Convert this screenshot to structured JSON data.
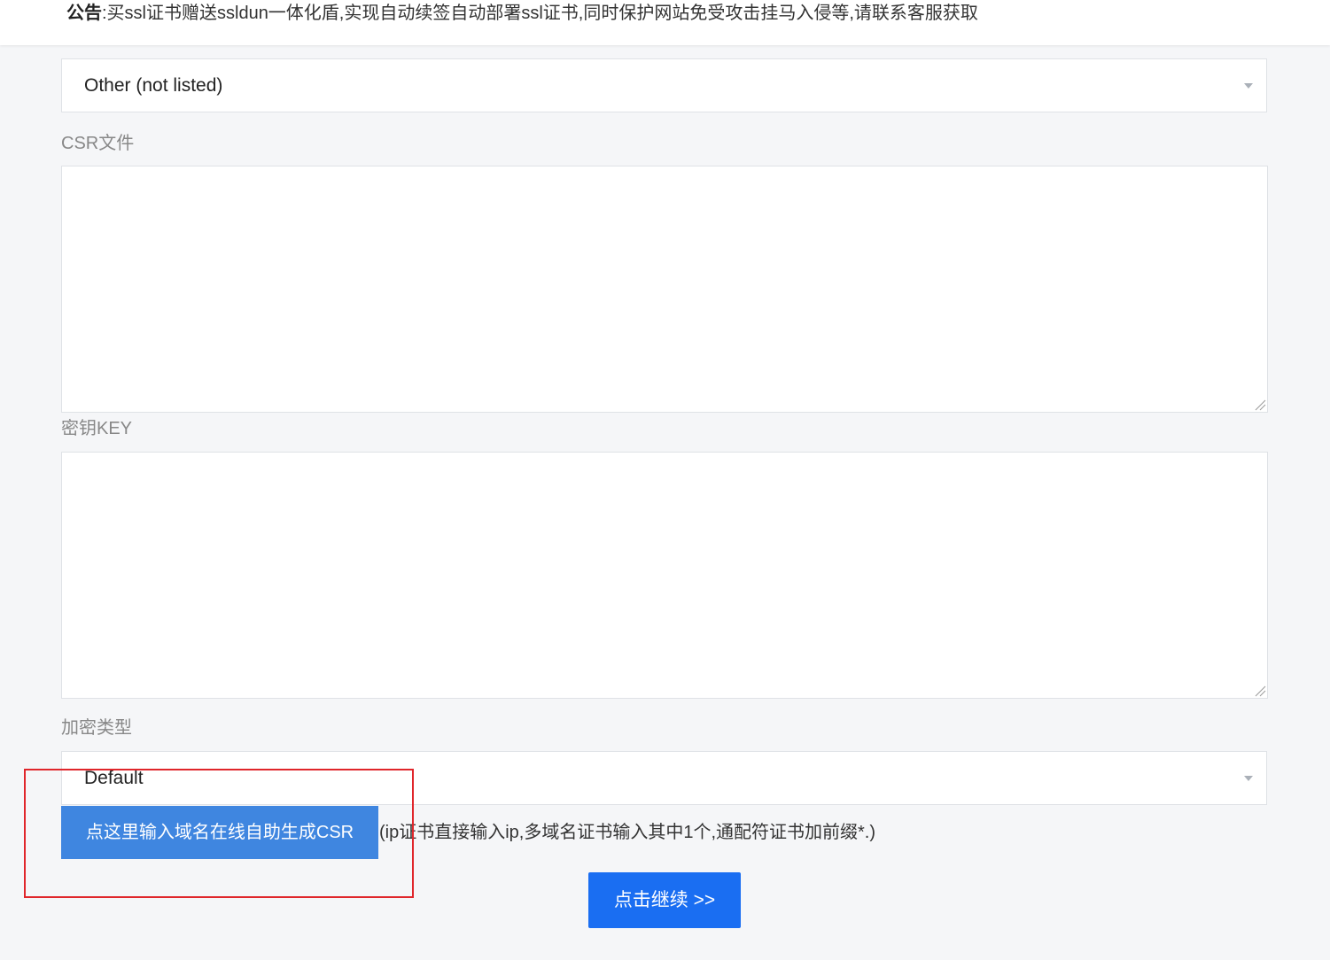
{
  "notice": {
    "label": "公告",
    "text": ":买ssl证书赠送ssldun一体化盾,实现自动续签自动部署ssl证书,同时保护网站免受攻击挂马入侵等,请联系客服获取"
  },
  "server_type": {
    "selected": "Other (not listed)"
  },
  "csr": {
    "label": "CSR文件",
    "value": ""
  },
  "key": {
    "label": "密钥KEY",
    "value": ""
  },
  "encryption": {
    "label": "加密类型",
    "selected": "Default"
  },
  "generate_csr": {
    "button_label": "点这里输入域名在线自助生成CSR",
    "hint": "(ip证书直接输入ip,多域名证书输入其中1个,通配符证书加前缀*.)"
  },
  "continue": {
    "label": "点击继续 >>"
  },
  "colors": {
    "primary": "#1a6ef2",
    "csr_button": "#3f86e0",
    "highlight": "#e0262b",
    "background": "#f5f6f8"
  }
}
